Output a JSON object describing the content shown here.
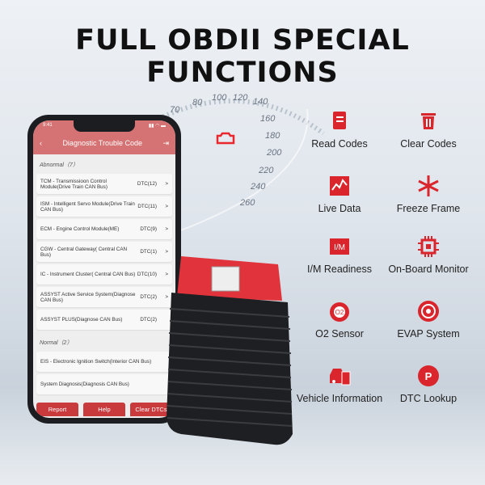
{
  "title": "FULL OBDII SPECIAL FUNCTIONS",
  "gauge": {
    "ticks": [
      "70",
      "80",
      "100",
      "120",
      "140",
      "160",
      "180",
      "200",
      "220",
      "240",
      "260"
    ]
  },
  "phone": {
    "time": "9:41",
    "header": "Diagnostic Trouble Code",
    "abnormal": "Abnormal（7）",
    "normal": "Normal（2）",
    "abnormal_items": [
      {
        "name": "TCM - Transmissioon Control Module(Drive Train CAN Bus)",
        "dtc": "DTC(12)",
        "arrow": ">"
      },
      {
        "name": "ISM - Intelligent Servo Module(Drive Train CAN Bus)",
        "dtc": "DTC(11)",
        "arrow": ">"
      },
      {
        "name": "ECM - Engine Control Module(ME)",
        "dtc": "DTC(9)",
        "arrow": ">"
      },
      {
        "name": "CGW - Central Gateway( Central CAN Bus)",
        "dtc": "DTC(1)",
        "arrow": ">"
      },
      {
        "name": "IC - Instrument Cluster( Central CAN Bus)",
        "dtc": "DTC(10)",
        "arrow": ">"
      },
      {
        "name": "ASSYST Active Service System(Diagnose CAN Bus)",
        "dtc": "DTC(2)",
        "arrow": ">"
      },
      {
        "name": "ASSYST PLUS(Diagnose CAN Bus)",
        "dtc": "DTC(2)",
        "arrow": ""
      }
    ],
    "normal_items": [
      {
        "name": "EIS - Electronic Ignition Switch(Interior CAN Bus)"
      },
      {
        "name": "System Diagnosis(Diagnosis CAN Bus)"
      }
    ],
    "buttons": [
      "Report",
      "Help",
      "Clear DTCs"
    ]
  },
  "features": [
    {
      "label": "Read Codes",
      "icon": "read-codes-icon"
    },
    {
      "label": "Clear Codes",
      "icon": "trash-icon"
    },
    {
      "label": "Live Data",
      "icon": "live-data-icon"
    },
    {
      "label": "Freeze Frame",
      "icon": "snowflake-icon"
    },
    {
      "label": "I/M Readiness",
      "icon": "im-icon"
    },
    {
      "label": "On-Board Monitor",
      "icon": "chip-icon"
    },
    {
      "label": "O2 Sensor",
      "icon": "o2-icon"
    },
    {
      "label": "EVAP System",
      "icon": "evap-icon"
    },
    {
      "label": "Vehicle Information",
      "icon": "vehicle-info-icon"
    },
    {
      "label": "DTC Lookup",
      "icon": "dtc-lookup-icon"
    }
  ],
  "accent": "#d9252b"
}
